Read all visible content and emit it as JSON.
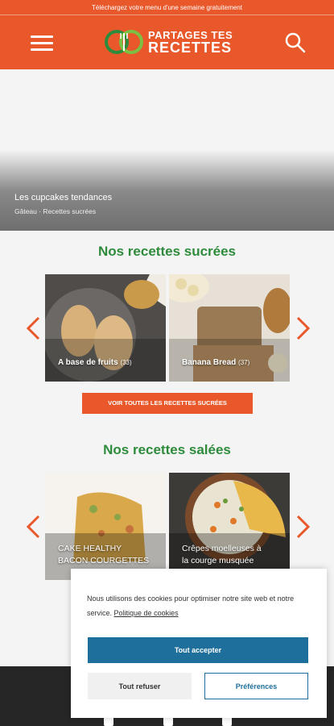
{
  "promo_bar": {
    "text": "Téléchargez votre menu d'une semaine gratuitement"
  },
  "header": {
    "logo_line1": "PARTAGES TES",
    "logo_line2": "RECETTES",
    "menu_icon": "hamburger-icon",
    "search_icon": "search-icon"
  },
  "hero": {
    "title": "Les cupcakes tendances",
    "tags": "Gâteau · Recettes sucrées"
  },
  "sweet": {
    "title": "Nos recettes sucrées",
    "cards": [
      {
        "label": "A base de fruits",
        "count": "(33)"
      },
      {
        "label": "Banana Bread",
        "count": "(37)"
      }
    ],
    "cta": "VOIR TOUTES LES RECETTES SUCRÉES"
  },
  "savory": {
    "title": "Nos recettes salées",
    "cards": [
      {
        "line1": "CAKE HEALTHY",
        "line2": "BACON COURGETTES"
      },
      {
        "line1": "Crêpes moelleuses à",
        "line2": "la courge musquée"
      }
    ]
  },
  "cookie_banner": {
    "text": "Nous utilisons des cookies pour optimiser notre site web et notre service.",
    "policy_link": "Politique de cookies",
    "accept": "Tout accepter",
    "refuse": "Tout refuser",
    "preferences": "Préférences"
  },
  "footer": {
    "icons": [
      "instagram-icon",
      "facebook-icon",
      "pinterest-icon"
    ]
  },
  "colors": {
    "brand": "#e8582a",
    "green": "#2e8b3b",
    "blue": "#1f6f9c"
  }
}
